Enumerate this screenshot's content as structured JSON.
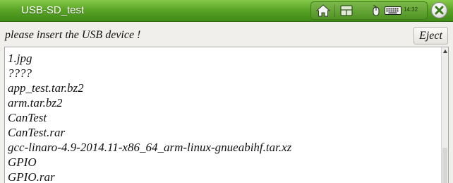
{
  "window": {
    "title": "USB-SD_test",
    "close_icon": "close-x-icon",
    "accent": "#5aa526"
  },
  "tray": {
    "home_icon": "home-icon",
    "window_icon": "window-switch-icon",
    "mouse_icon": "mouse-icon",
    "keyboard_icon": "keyboard-icon",
    "clock": "14:32"
  },
  "prompt": {
    "text": "please insert the USB device !"
  },
  "toolbar": {
    "eject_label": "Eject"
  },
  "file_list": {
    "items": [
      "1.jpg",
      "????",
      "app_test.tar.bz2",
      "arm.tar.bz2",
      "CanTest",
      "CanTest.rar",
      "gcc-linaro-4.9-2014.11-x86_64_arm-linux-gnueabihf.tar.xz",
      "GPIO",
      "GPIO.rar"
    ]
  }
}
